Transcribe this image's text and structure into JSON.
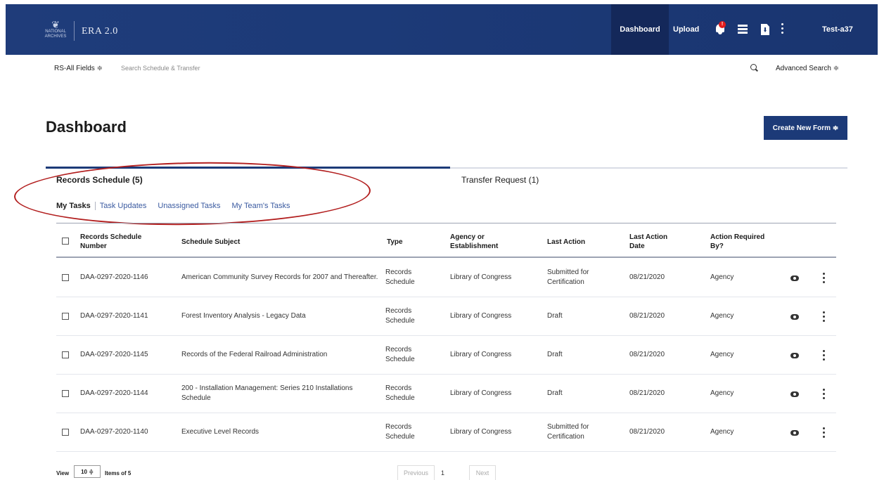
{
  "header": {
    "logo_text": "NATIONAL ARCHIVES",
    "app_title": "ERA 2.0",
    "nav_dashboard": "Dashboard",
    "nav_upload": "Upload",
    "notification_count": "!",
    "user": "Test-a37",
    "colors": {
      "bar": "#1c3a78",
      "active": "#14285a",
      "alert": "#e31c1c"
    }
  },
  "search": {
    "scope": "RS-All Fields ≑",
    "placeholder": "Search Schedule & Transfer",
    "advanced": "Advanced Search ≑"
  },
  "page": {
    "title": "Dashboard",
    "create_button": "Create New Form ≑"
  },
  "tabs": {
    "records": "Records Schedule (5)",
    "transfer": "Transfer Request (1)"
  },
  "subtabs": {
    "my_tasks": "My Tasks",
    "task_updates": "Task Updates",
    "unassigned": "Unassigned Tasks",
    "team": "My Team's Tasks"
  },
  "table": {
    "headers": {
      "number_1": "Records Schedule",
      "number_2": "Number",
      "subject": "Schedule Subject",
      "type": "Type",
      "agency_1": "Agency or",
      "agency_2": "Establishment",
      "last_action": "Last Action",
      "date_1": "Last Action",
      "date_2": "Date",
      "required_1": "Action Required",
      "required_2": "By?"
    },
    "rows": [
      {
        "number": "DAA-0297-2020-1146",
        "subject_1": "American Community Survey Records for 2007 and Thereafter.",
        "subject_2": "",
        "type_1": "Records",
        "type_2": "Schedule",
        "agency": "Library of Congress",
        "action_1": "Submitted for",
        "action_2": "Certification",
        "date": "08/21/2020",
        "required": "Agency"
      },
      {
        "number": "DAA-0297-2020-1141",
        "subject_1": "Forest Inventory Analysis - Legacy Data",
        "subject_2": "",
        "type_1": "Records",
        "type_2": "Schedule",
        "agency": "Library of Congress",
        "action_1": "Draft",
        "action_2": "",
        "date": "08/21/2020",
        "required": "Agency"
      },
      {
        "number": "DAA-0297-2020-1145",
        "subject_1": "Records of the Federal Railroad Administration",
        "subject_2": "",
        "type_1": "Records",
        "type_2": "Schedule",
        "agency": "Library of Congress",
        "action_1": "Draft",
        "action_2": "",
        "date": "08/21/2020",
        "required": "Agency"
      },
      {
        "number": "DAA-0297-2020-1144",
        "subject_1": "200 - Installation Management: Series 210 Installations",
        "subject_2": "Schedule",
        "type_1": "Records",
        "type_2": "Schedule",
        "agency": "Library of Congress",
        "action_1": "Draft",
        "action_2": "",
        "date": "08/21/2020",
        "required": "Agency"
      },
      {
        "number": "DAA-0297-2020-1140",
        "subject_1": "Executive Level Records",
        "subject_2": "",
        "type_1": "Records",
        "type_2": "Schedule",
        "agency": "Library of Congress",
        "action_1": "Submitted for",
        "action_2": "Certification",
        "date": "08/21/2020",
        "required": "Agency"
      }
    ]
  },
  "pager": {
    "view": "View",
    "page_size": "10 ≑",
    "items": "Items of 5",
    "previous": "Previous",
    "page": "1",
    "next": "Next"
  }
}
